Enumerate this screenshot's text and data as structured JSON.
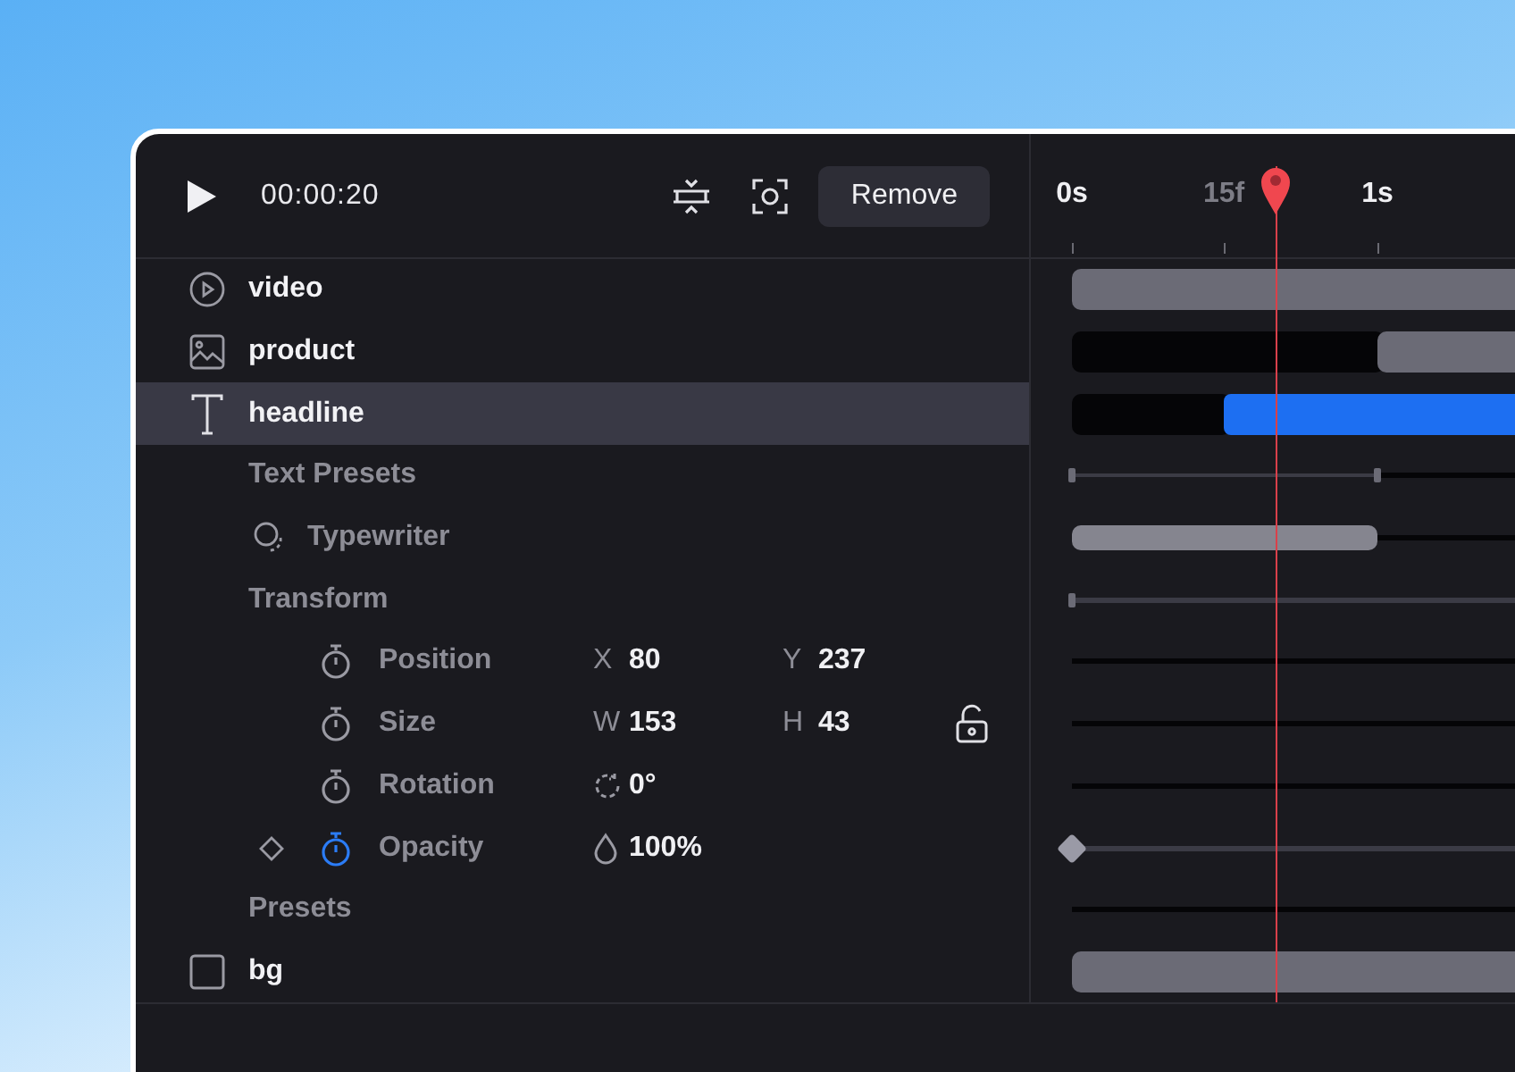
{
  "toolbar": {
    "time": "00:00:20",
    "remove_button": "Remove"
  },
  "ruler": {
    "labels": [
      "0s",
      "15f",
      "1s"
    ]
  },
  "rows": [
    {
      "kind": "video",
      "name": "video",
      "selected": false
    },
    {
      "kind": "image",
      "name": "product",
      "selected": false
    },
    {
      "kind": "text",
      "name": "headline",
      "selected": true
    },
    {
      "kind": "section",
      "label": "Text Presets"
    },
    {
      "kind": "preset",
      "name": "Typewriter"
    },
    {
      "kind": "section",
      "label": "Transform"
    },
    {
      "kind": "property",
      "name": "Position",
      "animated": false,
      "fields": [
        {
          "kind": "letter",
          "label": "X",
          "value": "80"
        },
        {
          "kind": "letter",
          "label": "Y",
          "value": "237"
        }
      ]
    },
    {
      "kind": "property",
      "name": "Size",
      "animated": false,
      "locked": false,
      "fields": [
        {
          "kind": "letter",
          "label": "W",
          "value": "153"
        },
        {
          "kind": "letter",
          "label": "H",
          "value": "43"
        }
      ]
    },
    {
      "kind": "property",
      "name": "Rotation",
      "animated": false,
      "fields": [
        {
          "kind": "rotate",
          "value": "0°"
        }
      ]
    },
    {
      "kind": "property",
      "name": "Opacity",
      "animated": true,
      "fields": [
        {
          "kind": "opacity",
          "value": "100%"
        }
      ]
    },
    {
      "kind": "section",
      "label": "Presets"
    },
    {
      "kind": "shape",
      "name": "bg",
      "selected": false
    }
  ]
}
